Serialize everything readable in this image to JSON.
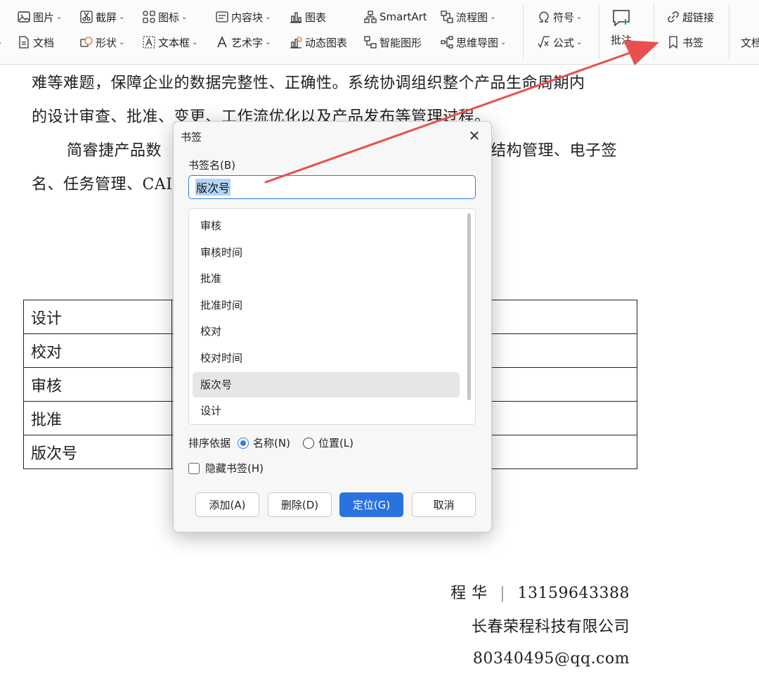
{
  "ribbon": {
    "row1": {
      "picture": "图片",
      "screenshot": "截屏",
      "icons": "图标",
      "content_block": "内容块",
      "chart": "图表",
      "smartart": "SmartArt",
      "flowchart": "流程图",
      "symbol": "符号",
      "hyperlink": "超链接"
    },
    "row2": {
      "document": "文档",
      "shapes": "形状",
      "textbox": "文本框",
      "wordart": "艺术字",
      "dynamic_chart": "动态图表",
      "smart_graphic": "智能图形",
      "mindmap": "思维导图",
      "formula": "公式",
      "bookmark": "书签",
      "doc_cut": "文档"
    },
    "comment": "批注"
  },
  "document": {
    "line1": "难等难题，保障企业的数据完整性、正确性。系统协调组织整个产品生命周期内",
    "line2": "的设计审查、批准、变更、工作流优化以及产品发布等管理过程。",
    "line3a": "简睿捷产品数",
    "line3b": "结构管理、电子签",
    "line4": "名、任务管理、CAI",
    "table_rows": [
      "设计",
      "校对",
      "审核",
      "批准",
      "版次号"
    ],
    "signature": {
      "name": "程 华",
      "divider": "|",
      "phone": "13159643388",
      "company": "长春荣程科技有限公司",
      "email": "80340495@qq.com"
    }
  },
  "dialog": {
    "title": "书签",
    "name_label": "书签名(B)",
    "name_value": "版次号",
    "list_items": [
      "审核",
      "审核时间",
      "批准",
      "批准时间",
      "校对",
      "校对时间",
      "版次号",
      "设计"
    ],
    "selected_item": "版次号",
    "sort_label": "排序依据",
    "sort_by_name": "名称(N)",
    "sort_by_position": "位置(L)",
    "sort_selected": "name",
    "hide_label": "隐藏书签(H)",
    "hide_checked": false,
    "buttons": {
      "add": "添加(A)",
      "delete": "删除(D)",
      "goto": "定位(G)",
      "cancel": "取消"
    }
  },
  "colors": {
    "accent": "#2a72e0",
    "arrow": "#e8504f",
    "selection": "#b3d3f7"
  }
}
